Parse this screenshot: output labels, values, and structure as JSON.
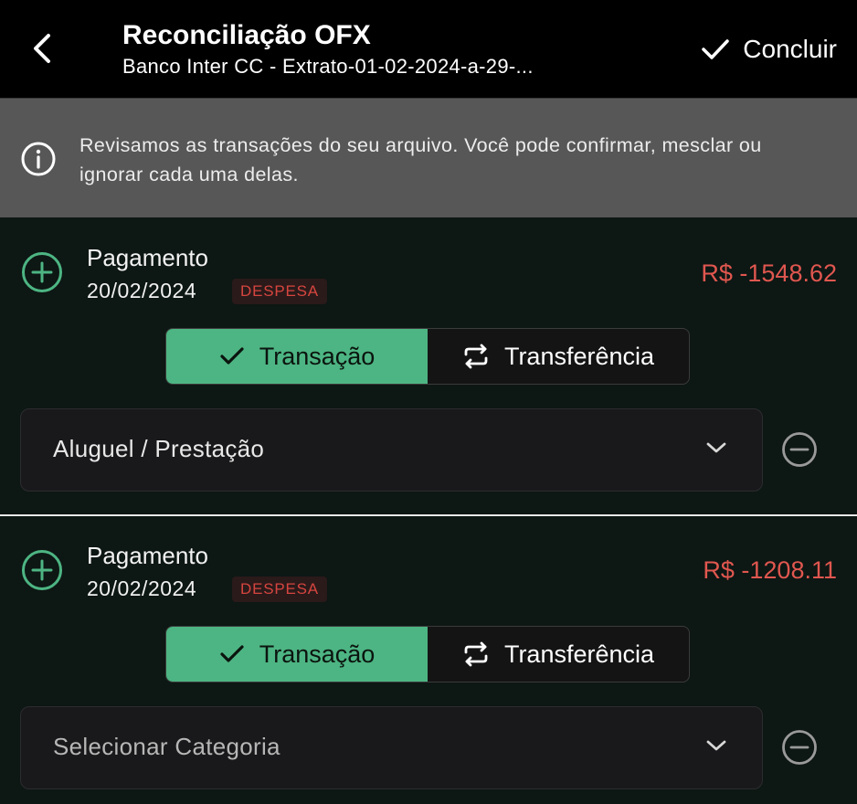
{
  "header": {
    "title": "Reconciliação OFX",
    "subtitle": "Banco Inter CC - Extrato-01-02-2024-a-29-...",
    "back_icon": "chevron-left-icon",
    "done_icon": "check-icon",
    "done_label": "Concluir"
  },
  "banner": {
    "icon": "info-icon",
    "text": "Revisamos as transações do seu arquivo. Você pode confirmar, mesclar ou ignorar cada uma delas."
  },
  "colors": {
    "header_bg": "#000000",
    "banner_bg": "#575757",
    "card_bg": "#0d1714",
    "accent_green": "#4db583",
    "expense_red": "#e0574f",
    "badge_red": "#d6453f"
  },
  "transactions": [
    {
      "name": "Pagamento",
      "date": "20/02/2024",
      "badge": "DESPESA",
      "amount": "R$ -1548.62",
      "segments": {
        "transaction_label": "Transação",
        "transfer_label": "Transferência",
        "selected": "Transação"
      },
      "category": "Aluguel / Prestação",
      "category_is_placeholder": false
    },
    {
      "name": "Pagamento",
      "date": "20/02/2024",
      "badge": "DESPESA",
      "amount": "R$ -1208.11",
      "segments": {
        "transaction_label": "Transação",
        "transfer_label": "Transferência",
        "selected": "Transação"
      },
      "category": "Selecionar Categoria",
      "category_is_placeholder": true
    }
  ]
}
